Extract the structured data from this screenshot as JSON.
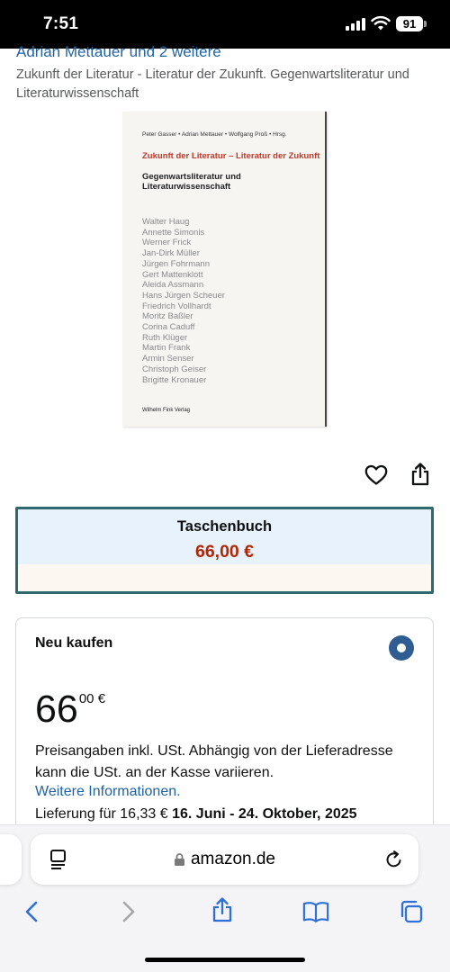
{
  "status": {
    "time": "7:51",
    "battery": "91"
  },
  "product": {
    "authors": "Adrian Mettauer und 2 weitere",
    "title": "Zukunft der Literatur - Literatur der Zukunft. Gegenwartsliteratur und Literaturwissenschaft"
  },
  "cover": {
    "editors": "Peter Gasser • Adrian Mettauer • Wolfgang Proß • Hrsg.",
    "title_red": "Zukunft der Literatur – Literatur der Zukunft",
    "subtitle": "Gegenwartsliteratur und Literaturwissenschaft",
    "names": [
      "Walter Haug",
      "Annette Simonis",
      "Werner Frick",
      "Jan-Dirk Müller",
      "Jürgen Fohrmann",
      "Gert Mattenklott",
      "Aleida Assmann",
      "Hans Jürgen Scheuer",
      "Friedrich Vollhardt",
      "Moritz Baßler",
      "Corina Caduff",
      "Ruth Klüger",
      "Martin Frank",
      "Armin Senser",
      "Christoph Geiser",
      "Brigitte Kronauer"
    ],
    "publisher": "Wilhelm Fink Verlag"
  },
  "actions": {
    "wishlist_icon": "heart-icon",
    "share_icon": "share-icon"
  },
  "format": {
    "label": "Taschenbuch",
    "price": "66,00 €"
  },
  "buy_box": {
    "title": "Neu kaufen",
    "price_whole": "66",
    "price_fraction": "00 €",
    "price_note": "Preisangaben inkl. USt. Abhängig von der Lieferadresse kann die USt. an der Kasse variieren.",
    "more_info": "Weitere Informationen.",
    "delivery_prefix": "Lieferung für 16,33 € ",
    "delivery_dates": "16. Juni - 24. Oktober, 2025"
  },
  "browser": {
    "url": "amazon.de",
    "icons": [
      "reader-icon",
      "lock-icon",
      "reload-icon",
      "back-icon",
      "forward-icon",
      "share-icon",
      "bookmarks-icon",
      "tabs-icon"
    ]
  },
  "colors": {
    "link": "#2162a1",
    "price_red": "#b12704",
    "format_border": "#2d6a6f",
    "radio": "#2f5d91"
  }
}
